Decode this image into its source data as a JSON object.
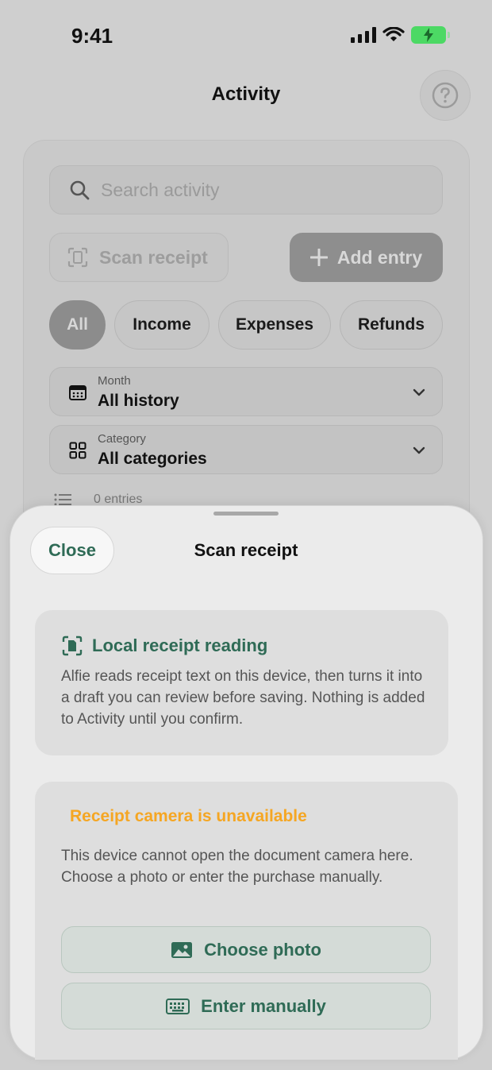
{
  "status_bar": {
    "time": "9:41"
  },
  "nav": {
    "title": "Activity",
    "help_icon": "question-circle-icon"
  },
  "search": {
    "placeholder": "Search activity"
  },
  "actions": {
    "scan_label": "Scan receipt",
    "add_label": "Add entry"
  },
  "filters": [
    {
      "label": "All",
      "active": true
    },
    {
      "label": "Income",
      "active": false
    },
    {
      "label": "Expenses",
      "active": false
    },
    {
      "label": "Refunds",
      "active": false
    }
  ],
  "month_filter": {
    "label": "Month",
    "value": "All history"
  },
  "category_filter": {
    "label": "Category",
    "value": "All categories"
  },
  "entries_summary": "0 entries",
  "sheet": {
    "title": "Scan receipt",
    "close_label": "Close",
    "info": {
      "title": "Local receipt reading",
      "body": "Alfie reads receipt text on this device, then turns it into a draft you can review before saving. Nothing is added to Activity until you confirm."
    },
    "warning": {
      "title": "Receipt camera is unavailable",
      "body": "This device cannot open the document camera here. Choose a photo or enter the purchase manually."
    },
    "choose_photo_label": "Choose photo",
    "enter_manually_label": "Enter manually"
  },
  "colors": {
    "accent_green": "#2f6b56",
    "warning_orange": "#f5a623",
    "battery_green": "#4cd964"
  }
}
